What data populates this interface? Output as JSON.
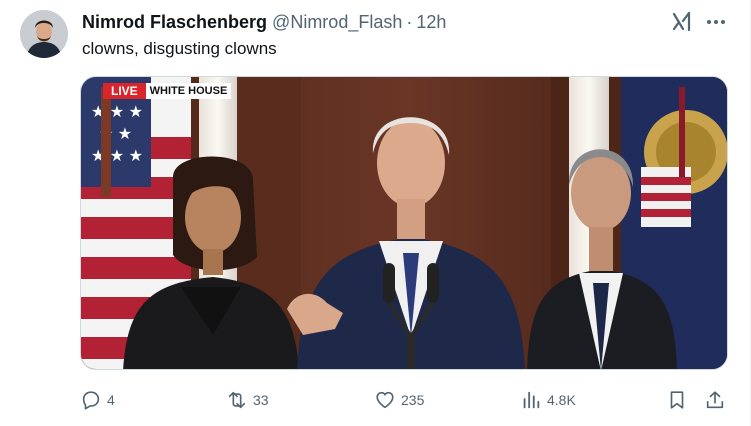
{
  "tweet": {
    "author": {
      "display_name": "Nimrod Flaschenberg",
      "handle": "@Nimrod_Flash",
      "avatar_icon": "profile-photo"
    },
    "separator": "·",
    "time": "12h",
    "text": "clowns, disgusting clowns",
    "header_icons": [
      "grok-icon",
      "more-icon"
    ],
    "media": {
      "type": "video-still",
      "badge_live": "LIVE",
      "badge_location": "WHITE HOUSE",
      "colors": {
        "background_wood": "#5a2e21",
        "flag_red": "#b22234",
        "live_red": "#d8262c"
      }
    },
    "actions": {
      "replies": "4",
      "reposts": "33",
      "likes": "235",
      "views": "4.8K"
    },
    "action_icons": [
      "reply-icon",
      "repost-icon",
      "like-icon",
      "views-icon",
      "bookmark-icon",
      "share-icon"
    ]
  },
  "colors": {
    "text_primary": "#0f1419",
    "text_secondary": "#536471",
    "border": "#cfd9de"
  }
}
